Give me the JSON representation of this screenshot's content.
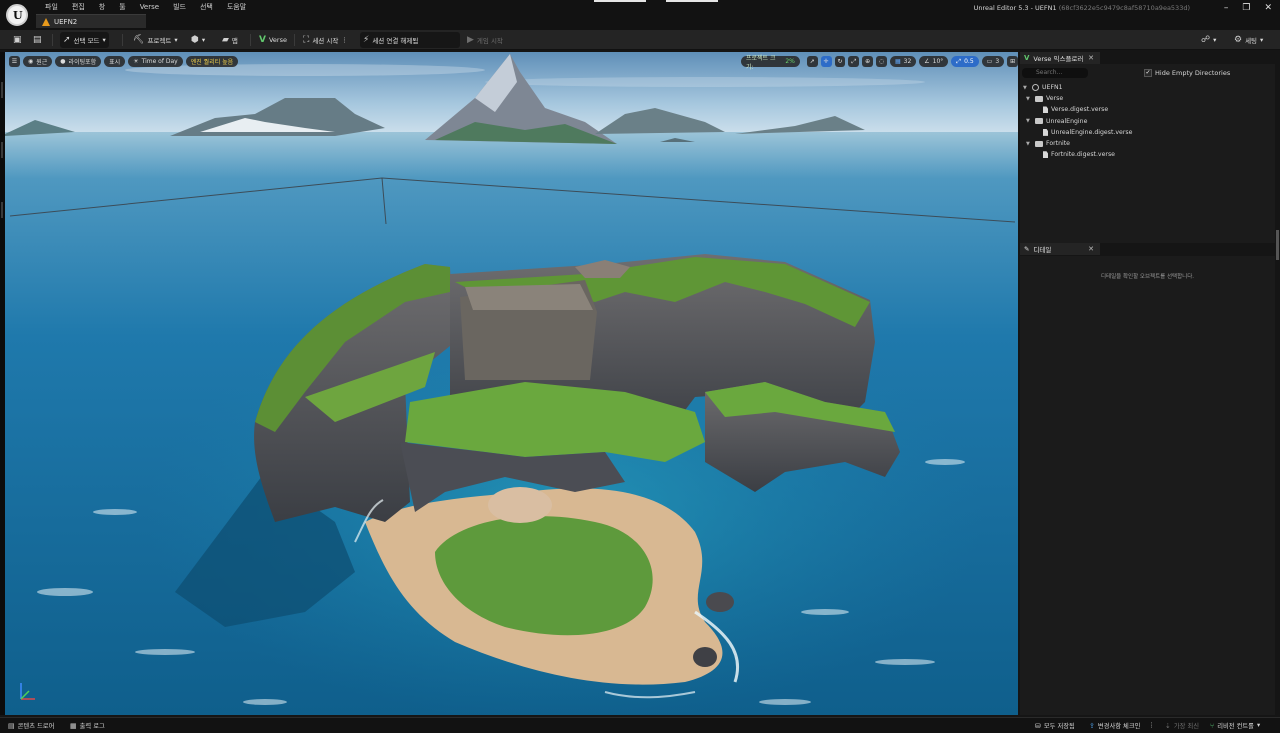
{
  "titlebar": {
    "menu": [
      "파일",
      "편집",
      "창",
      "툴",
      "Verse",
      "빌드",
      "선택",
      "도움말"
    ],
    "doc_tab": "UEFN2",
    "window_title": "Unreal Editor 5.3 - UEFN1",
    "window_hash": "(68cf3622e5c9479c8af58710a9ea533d)",
    "controls": [
      "–",
      "❐",
      "✕"
    ]
  },
  "toolbar": {
    "mode": "선택 모드",
    "project": "프로젝트",
    "map": "맵",
    "verse": "Verse",
    "session": "세션 시작",
    "disconnect": "세션 연결 해제됨",
    "play": "게임 시작",
    "settings": "세팅"
  },
  "viewport": {
    "left_pills": [
      "원근",
      "라이팅포함",
      "표시",
      "Time of Day",
      "엔진 퀄리티 높음"
    ],
    "project_size_label": "프로젝트 크기:",
    "project_size_value": "2%",
    "grid_snap": "32",
    "rotation_snap": "10°",
    "scale_snap": "0.5",
    "camera_speed": "3"
  },
  "verse_explorer": {
    "tab": "Verse 익스플로러",
    "search_placeholder": "Search...",
    "hide_empty": "Hide Empty Directories",
    "tree": [
      {
        "label": "UEFN1",
        "kind": "root",
        "depth": 0
      },
      {
        "label": "Verse",
        "kind": "folder",
        "depth": 1
      },
      {
        "label": "Verse.digest.verse",
        "kind": "file",
        "depth": 2
      },
      {
        "label": "UnrealEngine",
        "kind": "folder",
        "depth": 1
      },
      {
        "label": "UnrealEngine.digest.verse",
        "kind": "file",
        "depth": 2
      },
      {
        "label": "Fortnite",
        "kind": "folder",
        "depth": 1
      },
      {
        "label": "Fortnite.digest.verse",
        "kind": "file",
        "depth": 2
      }
    ]
  },
  "details": {
    "tab": "디테일",
    "hint": "디테일을 확인할 오브젝트를 선택합니다."
  },
  "bottombar": {
    "content_drawer": "콘텐츠 드로어",
    "output_log": "출력 로그",
    "save_all": "모두 저장됨",
    "check_changes": "변경사항 체크인",
    "latest": "가장 최신",
    "revision_control": "리비전 컨트롤"
  },
  "colors": {
    "accent_blue": "#2d6cc8",
    "verse_green": "#62c86e",
    "tab_orange": "#e89a1c",
    "quality_yellow": "#f2d04b"
  }
}
